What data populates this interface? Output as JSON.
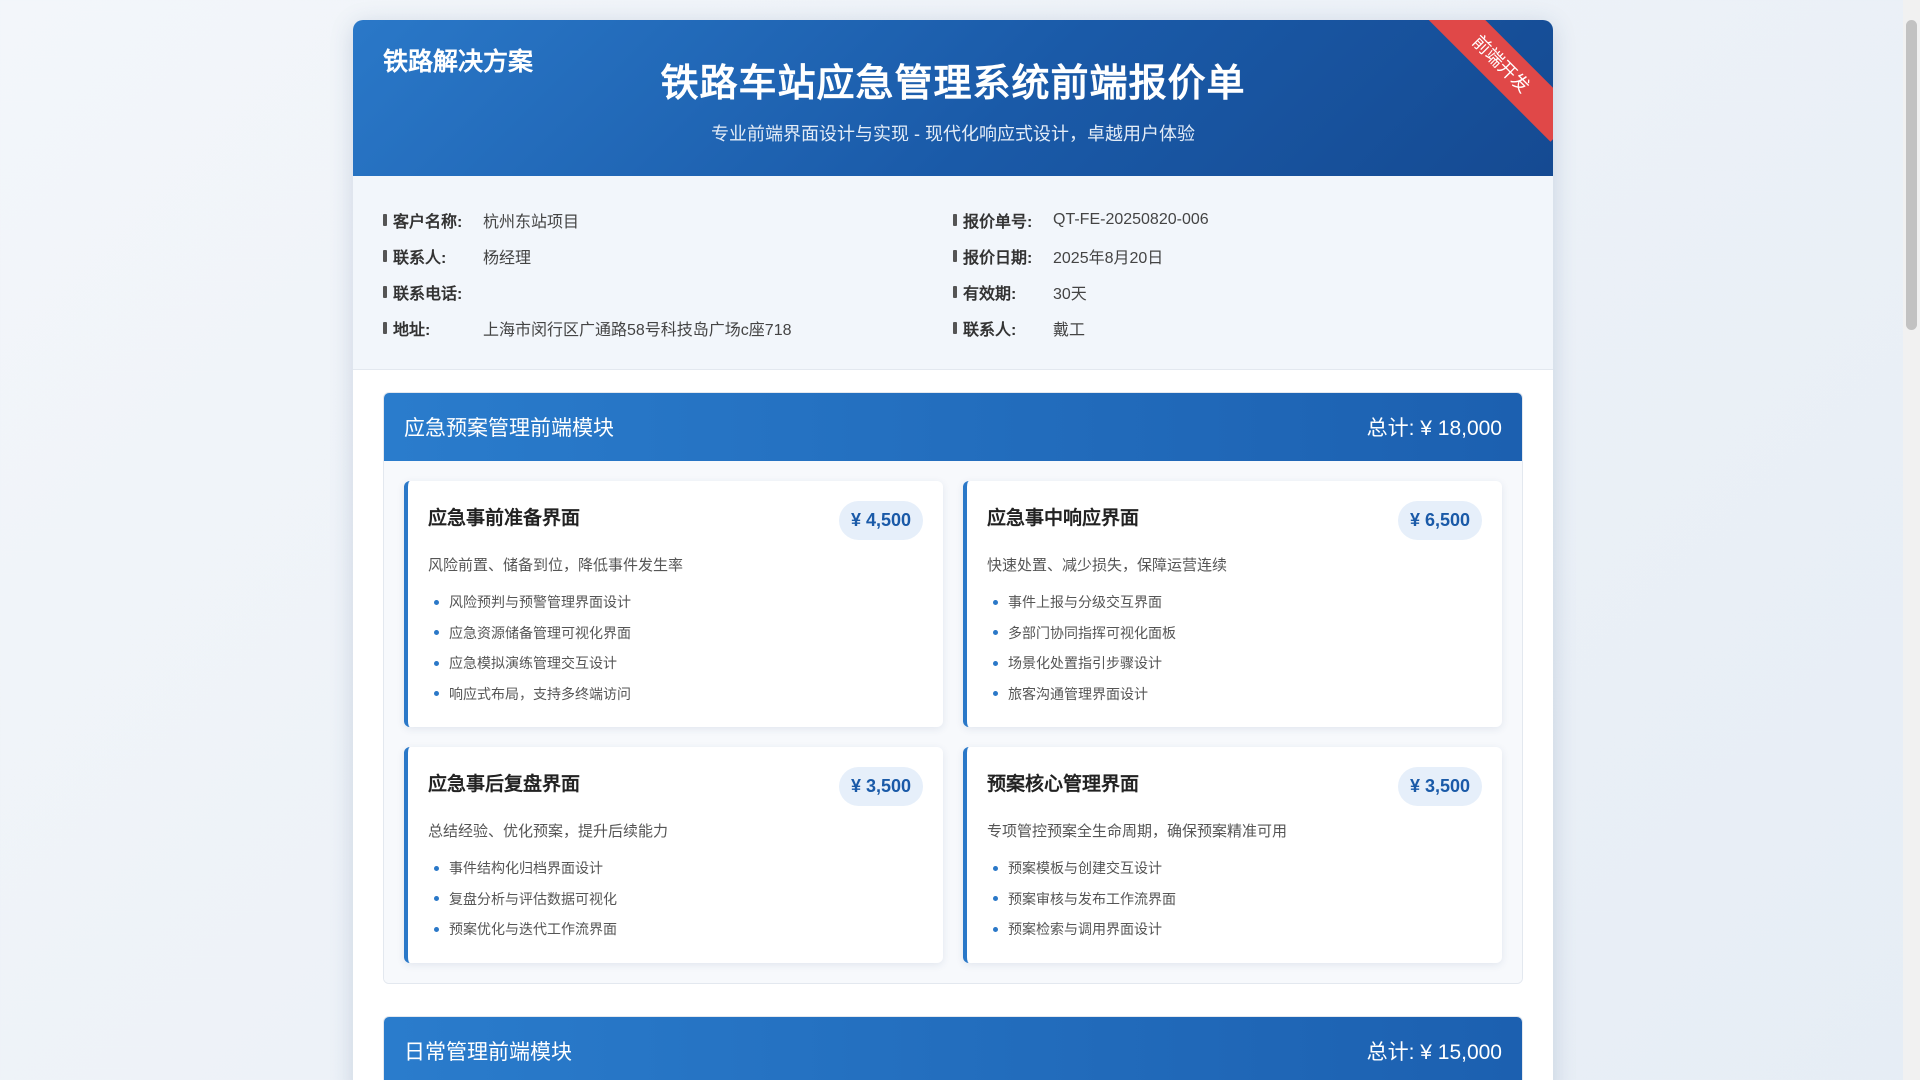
{
  "header": {
    "brand": "铁路解决方案",
    "title": "铁路车站应急管理系统前端报价单",
    "subtitle": "专业前端界面设计与实现 - 现代化响应式设计，卓越用户体验",
    "ribbon": "前端开发"
  },
  "info": {
    "left": [
      {
        "label": "客户名称:",
        "value": "杭州东站项目"
      },
      {
        "label": "联系人:",
        "value": "杨经理"
      },
      {
        "label": "联系电话:",
        "value": ""
      },
      {
        "label": "地址:",
        "value": "上海市闵行区广通路58号科技岛广场c座718"
      }
    ],
    "right": [
      {
        "label": "报价单号:",
        "value": "QT-FE-20250820-006"
      },
      {
        "label": "报价日期:",
        "value": "2025年8月20日"
      },
      {
        "label": "有效期:",
        "value": "30天"
      },
      {
        "label": "联系人:",
        "value": "戴工"
      }
    ]
  },
  "modules": [
    {
      "title": "应急预案管理前端模块",
      "total": "总计: ¥ 18,000",
      "items": [
        {
          "name": "应急事前准备界面",
          "price": "¥ 4,500",
          "desc": "风险前置、储备到位，降低事件发生率",
          "features": [
            "风险预判与预警管理界面设计",
            "应急资源储备管理可视化界面",
            "应急模拟演练管理交互设计",
            "响应式布局，支持多终端访问"
          ]
        },
        {
          "name": "应急事中响应界面",
          "price": "¥ 6,500",
          "desc": "快速处置、减少损失，保障运营连续",
          "features": [
            "事件上报与分级交互界面",
            "多部门协同指挥可视化面板",
            "场景化处置指引步骤设计",
            "旅客沟通管理界面设计"
          ]
        },
        {
          "name": "应急事后复盘界面",
          "price": "¥ 3,500",
          "desc": "总结经验、优化预案，提升后续能力",
          "features": [
            "事件结构化归档界面设计",
            "复盘分析与评估数据可视化",
            "预案优化与迭代工作流界面"
          ]
        },
        {
          "name": "预案核心管理界面",
          "price": "¥ 3,500",
          "desc": "专项管控预案全生命周期，确保预案精准可用",
          "features": [
            "预案模板与创建交互设计",
            "预案审核与发布工作流界面",
            "预案检索与调用界面设计"
          ]
        }
      ]
    },
    {
      "title": "日常管理前端模块",
      "total": "总计: ¥ 15,000",
      "items": []
    }
  ]
}
